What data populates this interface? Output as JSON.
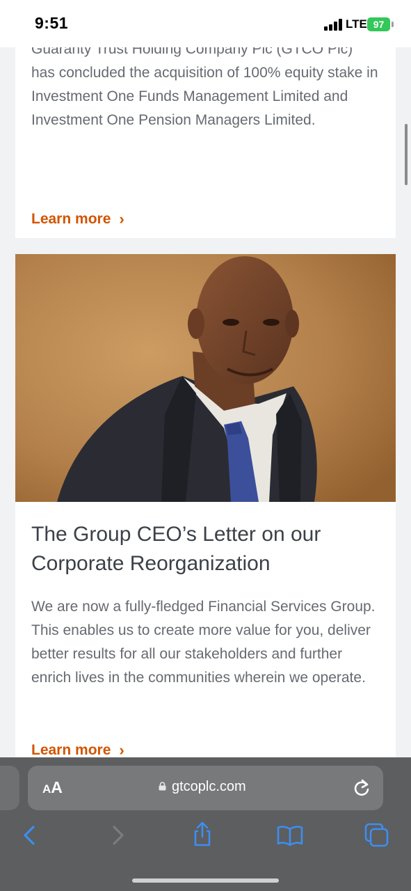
{
  "status_bar": {
    "time": "9:51",
    "network": "LTE",
    "battery": "97"
  },
  "cards": [
    {
      "description": "Guaranty Trust Holding Company Plc (GTCO Plc) has concluded the acquisition of 100% equity stake in Investment One Funds Management Limited and Investment One Pension Managers Limited.",
      "link_label": "Learn more"
    },
    {
      "image": "portrait of the Group CEO in a dark suit and blue patterned tie",
      "title": "The Group CEO’s Letter on our Corporate Reorganization",
      "description": "We are now a fully-fledged Financial Services Group. This enables us to create more value for you, deliver better results for all our stakeholders and further enrich lives in the communities wherein we operate.",
      "link_label": "Learn more"
    }
  ],
  "browser": {
    "text_size_small": "A",
    "text_size_big": "A",
    "url": "gtcoplc.com"
  },
  "colors": {
    "link": "#d35400",
    "toolbar": "#5c5e60",
    "toolbar_icon": "#3d8ef0"
  },
  "icons": [
    "lock-icon",
    "reload-icon",
    "back-icon",
    "forward-icon",
    "share-icon",
    "bookmarks-icon",
    "tabs-icon",
    "chevron-right-icon"
  ]
}
